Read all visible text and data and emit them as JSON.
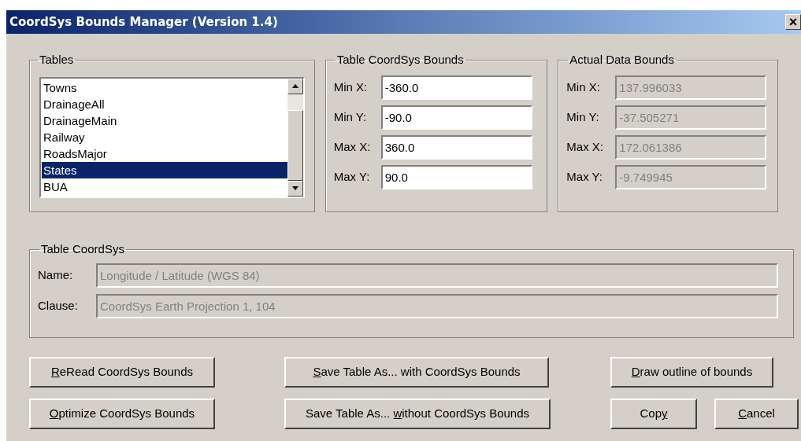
{
  "window": {
    "title": "CoordSys Bounds Manager (Version 1.4)",
    "close": "×"
  },
  "tables": {
    "label": "Tables",
    "items": [
      {
        "label": "Towns",
        "selected": false
      },
      {
        "label": "DrainageAll",
        "selected": false
      },
      {
        "label": "DrainageMain",
        "selected": false
      },
      {
        "label": "Railway",
        "selected": false
      },
      {
        "label": "RoadsMajor",
        "selected": false
      },
      {
        "label": "States",
        "selected": true
      },
      {
        "label": "BUA",
        "selected": false
      }
    ]
  },
  "table_bounds": {
    "label": "Table CoordSys Bounds",
    "fields": [
      {
        "label": "Min X:",
        "value": "-360.0",
        "disabled": false
      },
      {
        "label": "Min Y:",
        "value": "-90.0",
        "disabled": false
      },
      {
        "label": "Max X:",
        "value": "360.0",
        "disabled": false
      },
      {
        "label": "Max Y:",
        "value": "90.0",
        "disabled": false
      }
    ]
  },
  "actual_bounds": {
    "label": "Actual Data Bounds",
    "fields": [
      {
        "label": "Min X:",
        "value": "137.996033",
        "disabled": true
      },
      {
        "label": "Min Y:",
        "value": "-37.505271",
        "disabled": true
      },
      {
        "label": "Max X:",
        "value": "172.061386",
        "disabled": true
      },
      {
        "label": "Max Y:",
        "value": "-9.749945",
        "disabled": true
      }
    ]
  },
  "table_coordsys": {
    "label": "Table CoordSys",
    "fields": [
      {
        "label": "Name:",
        "value": "Longitude / Latitude (WGS 84)",
        "disabled": true
      },
      {
        "label": "Clause:",
        "value": "CoordSys Earth Projection 1, 104",
        "disabled": true
      }
    ]
  },
  "buttons": [
    {
      "access_key": "R",
      "text_after": "eRead CoordSys Bounds"
    },
    {
      "access_key": "S",
      "text_after": "ave Table As... with CoordSys Bounds"
    },
    {
      "access_key": "D",
      "text_after": "raw outline of bounds"
    },
    {
      "access_key": "O",
      "text_after": "ptimize CoordSys Bounds"
    },
    {
      "text_before": "Save Table As... ",
      "access_key": "w",
      "text_after": "ithout CoordSys Bounds"
    },
    {
      "text_before": "Cop",
      "access_key": "y"
    },
    {
      "access_key": "C",
      "text_after": "ancel"
    }
  ]
}
